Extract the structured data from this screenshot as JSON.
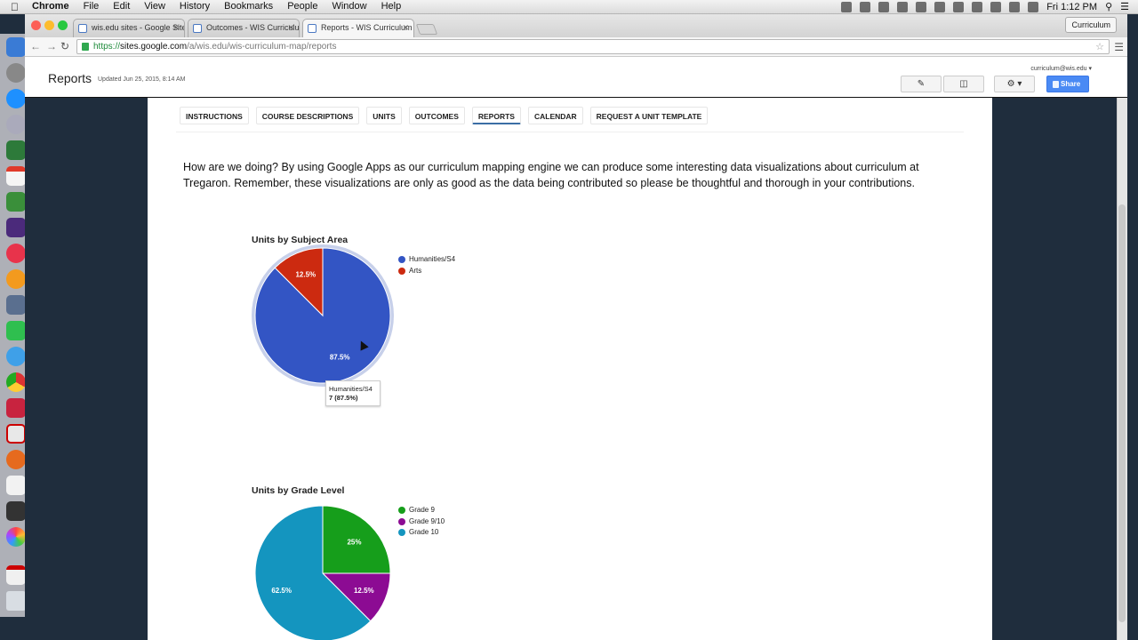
{
  "os_menubar": {
    "app": "Chrome",
    "items": [
      "File",
      "Edit",
      "View",
      "History",
      "Bookmarks",
      "People",
      "Window",
      "Help"
    ],
    "clock": "Fri 1:12 PM"
  },
  "browser": {
    "tabs": [
      {
        "title": "wis.edu sites - Google Sites"
      },
      {
        "title": "Outcomes - WIS Curriculum"
      },
      {
        "title": "Reports - WIS Curriculum"
      }
    ],
    "active_tab": 2,
    "url": {
      "scheme": "https://",
      "host": "sites.google.com",
      "path": "/a/wis.edu/wis-curriculum-map/reports"
    },
    "profile_button": "Curriculum"
  },
  "site_header": {
    "page_title": "Reports",
    "updated": "Updated Jun 25, 2015, 8:14 AM",
    "account": "curriculum@wis.edu",
    "share_label": "Share"
  },
  "nav": {
    "tabs": [
      "INSTRUCTIONS",
      "COURSE DESCRIPTIONS",
      "UNITS",
      "OUTCOMES",
      "REPORTS",
      "CALENDAR",
      "REQUEST A UNIT TEMPLATE"
    ],
    "active": "REPORTS"
  },
  "intro_text": "How are we doing?  By using Google Apps as our curriculum mapping engine we can produce some interesting data visualizations about curriculum at Tregaron.  Remember, these visualizations are only as good as the data being contributed so please be thoughtful and thorough in your contributions.",
  "tooltip": {
    "line1": "Humanities/S4",
    "line2": "7 (87.5%)"
  },
  "chart_data": [
    {
      "type": "pie",
      "title": "Units by Subject Area",
      "legend_position": "right",
      "categories": [
        "Humanities/S4",
        "Arts"
      ],
      "values": [
        7,
        1
      ],
      "labels": [
        "87.5%",
        "12.5%"
      ],
      "colors": [
        "#3355c4",
        "#cc2a10"
      ],
      "highlighted": "Humanities/S4"
    },
    {
      "type": "pie",
      "title": "Units by Grade Level",
      "legend_position": "right",
      "categories": [
        "Grade 9",
        "Grade 9/10",
        "Grade 10"
      ],
      "values": [
        2,
        1,
        5
      ],
      "labels": [
        "25%",
        "12.5%",
        "62.5%"
      ],
      "colors": [
        "#169e1b",
        "#8c0b93",
        "#1495bf"
      ]
    }
  ]
}
